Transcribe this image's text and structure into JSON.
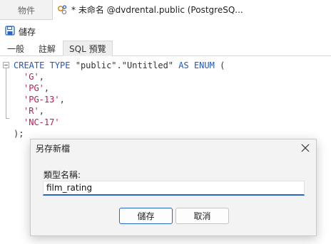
{
  "tabs": [
    {
      "label": "物件",
      "active": false
    },
    {
      "label": "* 未命名 @dvdrental.public (PostgreSQ...",
      "active": true
    }
  ],
  "toolbar": {
    "save_label": "儲存"
  },
  "sub_tabs": [
    {
      "label": "一般",
      "active": false
    },
    {
      "label": "註解",
      "active": false
    },
    {
      "label": "SQL 預覽",
      "active": true
    }
  ],
  "sql": {
    "kw_create": "CREATE",
    "kw_type": "TYPE",
    "schema": "\"public\"",
    "dot": ".",
    "name": "\"Untitled\"",
    "kw_as": "AS",
    "kw_enum": "ENUM",
    "open": " (",
    "values": [
      "'G'",
      "'PG'",
      "'PG-13'",
      "'R'",
      "'NC-17'"
    ],
    "close": ");"
  },
  "dialog": {
    "title": "另存新檔",
    "field_label": "類型名稱:",
    "field_value": "film_rating",
    "ok_label": "儲存",
    "cancel_label": "取消"
  },
  "colors": {
    "keyword": "#1f57c4",
    "string": "#c2185b",
    "accent": "#2a64c5"
  }
}
